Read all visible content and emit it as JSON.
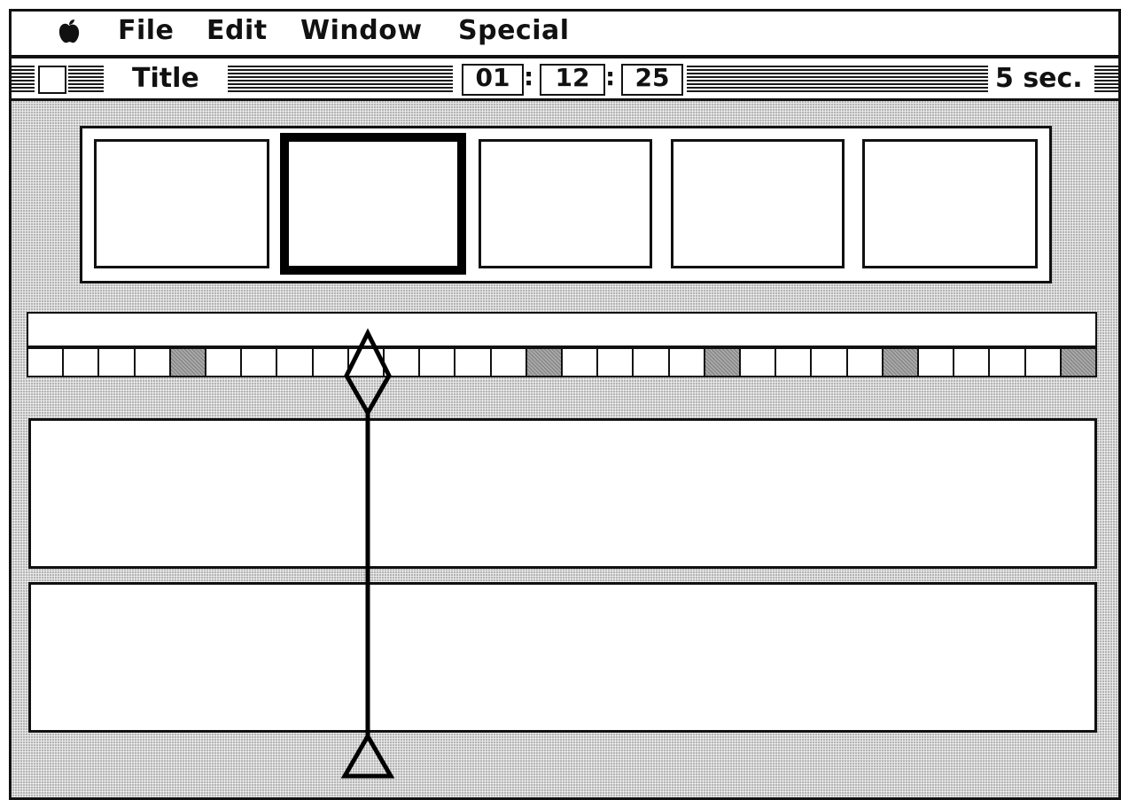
{
  "menubar": {
    "apple_icon": "apple-icon",
    "items": [
      "File",
      "Edit",
      "Window",
      "Special"
    ]
  },
  "window": {
    "title": "Title",
    "timecode": {
      "hours": "01",
      "minutes": "12",
      "seconds": "25",
      "separator": ":"
    },
    "duration": "5 sec."
  },
  "thumbnails": {
    "count": 5,
    "selected_index": 1
  },
  "timeline": {
    "segments": 30,
    "marked_segments": [
      4,
      14,
      19,
      24,
      29
    ]
  },
  "playhead": {
    "icons": [
      "diamond-handle-icon",
      "triangle-handle-icon"
    ]
  },
  "colors": {
    "pattern_gray": "#b4b4b4",
    "marked_segment": "#8c8c8c",
    "ink": "#111111"
  }
}
